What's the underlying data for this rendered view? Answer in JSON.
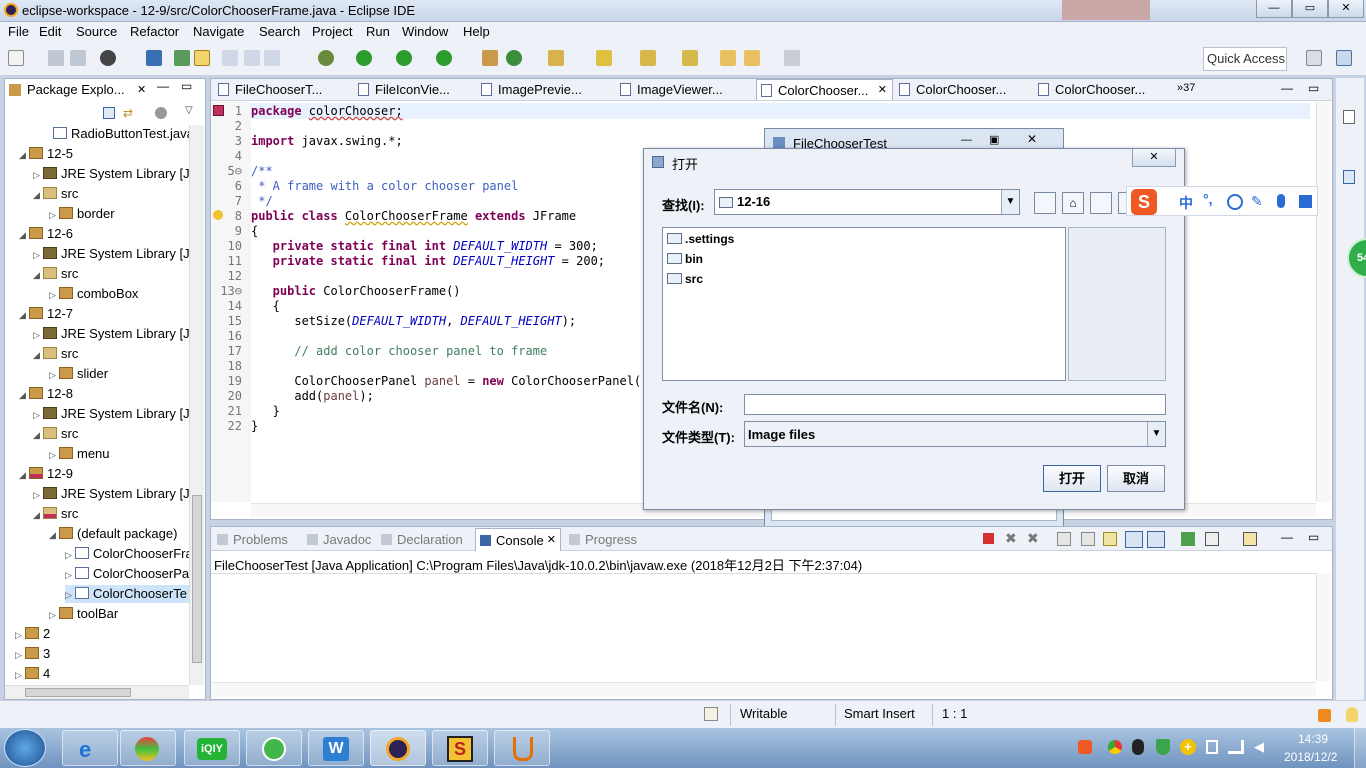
{
  "window": {
    "title": "eclipse-workspace - 12-9/src/ColorChooserFrame.java - Eclipse IDE",
    "minimize_icon": "minimize-icon",
    "maximize_icon": "maximize-icon",
    "close_icon": "close-icon"
  },
  "menu": [
    "File",
    "Edit",
    "Source",
    "Refactor",
    "Navigate",
    "Search",
    "Project",
    "Run",
    "Window",
    "Help"
  ],
  "quick_access": "Quick Access",
  "package_explorer": {
    "tab_label": "Package Explo...",
    "tree": [
      {
        "text": "RadioButtonTest.java",
        "icon": "java-file-icon"
      },
      {
        "text": "12-5",
        "icon": "project-icon"
      },
      {
        "text": "JRE System Library [Ja",
        "icon": "library-icon"
      },
      {
        "text": "src",
        "icon": "source-folder-icon"
      },
      {
        "text": "border",
        "icon": "package-icon"
      },
      {
        "text": "12-6",
        "icon": "project-icon"
      },
      {
        "text": "JRE System Library [Ja",
        "icon": "library-icon"
      },
      {
        "text": "src",
        "icon": "source-folder-icon"
      },
      {
        "text": "comboBox",
        "icon": "package-icon"
      },
      {
        "text": "12-7",
        "icon": "project-icon"
      },
      {
        "text": "JRE System Library [Ja",
        "icon": "library-icon"
      },
      {
        "text": "src",
        "icon": "source-folder-icon"
      },
      {
        "text": "slider",
        "icon": "package-icon"
      },
      {
        "text": "12-8",
        "icon": "project-icon"
      },
      {
        "text": "JRE System Library [Ja",
        "icon": "library-icon"
      },
      {
        "text": "src",
        "icon": "source-folder-icon"
      },
      {
        "text": "menu",
        "icon": "package-icon"
      },
      {
        "text": "12-9",
        "icon": "project-error-icon"
      },
      {
        "text": "JRE System Library [Ja",
        "icon": "library-icon"
      },
      {
        "text": "src",
        "icon": "source-folder-error-icon"
      },
      {
        "text": "(default package)",
        "icon": "package-icon"
      },
      {
        "text": "ColorChooserFra",
        "icon": "java-file-icon"
      },
      {
        "text": "ColorChooserPa",
        "icon": "java-file-icon"
      },
      {
        "text": "ColorChooserTe",
        "icon": "java-file-icon"
      },
      {
        "text": "toolBar",
        "icon": "package-icon"
      },
      {
        "text": "2",
        "icon": "project-icon"
      },
      {
        "text": "3",
        "icon": "project-icon"
      },
      {
        "text": "4",
        "icon": "project-icon"
      }
    ]
  },
  "editor": {
    "tabs": [
      {
        "label": "FileChooserT...",
        "active": false
      },
      {
        "label": "FileIconVie...",
        "active": false
      },
      {
        "label": "ImagePrevie...",
        "active": false
      },
      {
        "label": "ImageViewer...",
        "active": false
      },
      {
        "label": "ColorChooser...",
        "active": true
      },
      {
        "label": "ColorChooser...",
        "active": false
      },
      {
        "label": "ColorChooser...",
        "active": false
      }
    ],
    "overflow_label": "»37",
    "lines": [
      "1",
      "2",
      "3",
      "4",
      "5⊖",
      "6",
      "7",
      "8",
      "9",
      "10",
      "11",
      "12",
      "13⊖",
      "14",
      "15",
      "16",
      "17",
      "18",
      "19",
      "20",
      "21",
      "22"
    ],
    "code": {
      "l1_kw": "package ",
      "l1_rest": "colorChooser;",
      "l3_kw": "import",
      "l3_rest": " javax.swing.*;",
      "l5": "/**",
      "l6": " * A frame with a color chooser panel",
      "l7": " */",
      "l8_kw1": "public class ",
      "l8_name": "ColorChooserFrame",
      "l8_kw2": " extends ",
      "l8_rest": "JFrame",
      "l9": "{",
      "l10_kw": "   private static final int ",
      "l10_const": "DEFAULT_WIDTH",
      "l10_rest": " = 300;",
      "l11_kw": "   private static final int ",
      "l11_const": "DEFAULT_HEIGHT",
      "l11_rest": " = 200;",
      "l13_kw": "   public ",
      "l13_rest": "ColorChooserFrame()",
      "l14": "   {",
      "l15_a": "      setSize(",
      "l15_c1": "DEFAULT_WIDTH",
      "l15_b": ", ",
      "l15_c2": "DEFAULT_HEIGHT",
      "l15_d": ");",
      "l17": "      // add color chooser panel to frame",
      "l19_a": "      ColorChooserPanel ",
      "l19_var": "panel",
      "l19_b": " = ",
      "l19_kw": "new",
      "l19_c": " ColorChooserPanel();",
      "l20_a": "      add(",
      "l20_var": "panel",
      "l20_b": ");",
      "l21": "   }",
      "l22": "}"
    }
  },
  "background_window": {
    "title": "FileChooserTest"
  },
  "dialog": {
    "title": "打开",
    "lookin_label": "查找(I):",
    "lookin_value": "12-16",
    "files": [
      ".settings",
      "bin",
      "src"
    ],
    "filename_label": "文件名(N):",
    "filename_value": "",
    "filetype_label": "文件类型(T):",
    "filetype_value": "Image files",
    "open_button": "打开",
    "cancel_button": "取消"
  },
  "ime_toolbar": {
    "logo": "S",
    "lang": "中",
    "punct": "°,"
  },
  "bottom_panel": {
    "tabs": [
      "Problems",
      "Javadoc",
      "Declaration",
      "Console",
      "Progress"
    ],
    "active_tab": "Console",
    "console_header": "FileChooserTest [Java Application] C:\\Program Files\\Java\\jdk-10.0.2\\bin\\javaw.exe (2018年12月2日 下午2:37:04)"
  },
  "status": {
    "writable": "Writable",
    "insert_mode": "Smart Insert",
    "position": "1 : 1"
  },
  "side_badge": "54",
  "taskbar": {
    "time": "14:39",
    "date": "2018/12/2",
    "apps": [
      "ie-icon",
      "browser-icon",
      "iqiyi-icon",
      "360-icon",
      "wps-icon",
      "eclipse-icon",
      "sogou-icon",
      "java-icon"
    ]
  },
  "colors": {
    "accent": "#3399ff",
    "keyword": "#7f0055",
    "comment_doc": "#3f5fbf",
    "comment_line": "#3f7f5f",
    "constant": "#0000c0"
  }
}
